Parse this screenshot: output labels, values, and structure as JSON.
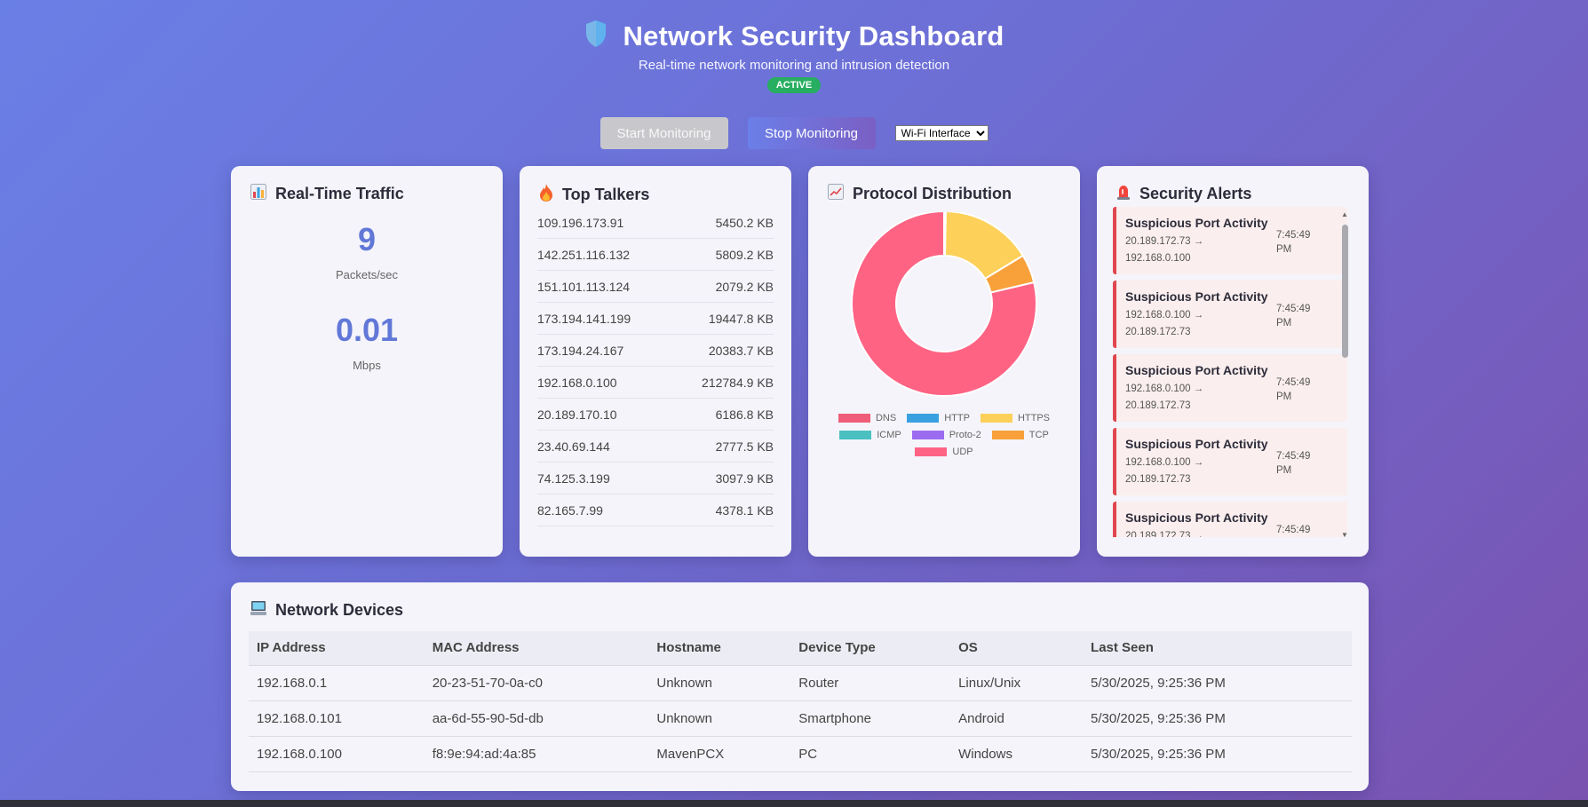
{
  "header": {
    "title": "Network Security Dashboard",
    "subtitle": "Real-time network monitoring and intrusion detection",
    "status_badge": "ACTIVE"
  },
  "controls": {
    "start_label": "Start Monitoring",
    "stop_label": "Stop Monitoring",
    "interface_selected": "Wi-Fi Interface"
  },
  "traffic": {
    "title": "Real-Time Traffic",
    "packets_value": "9",
    "packets_label": "Packets/sec",
    "mbps_value": "0.01",
    "mbps_label": "Mbps"
  },
  "talkers": {
    "title": "Top Talkers",
    "rows": [
      {
        "ip": "109.196.173.91",
        "size": "5450.2 KB"
      },
      {
        "ip": "142.251.116.132",
        "size": "5809.2 KB"
      },
      {
        "ip": "151.101.113.124",
        "size": "2079.2 KB"
      },
      {
        "ip": "173.194.141.199",
        "size": "19447.8 KB"
      },
      {
        "ip": "173.194.24.167",
        "size": "20383.7 KB"
      },
      {
        "ip": "192.168.0.100",
        "size": "212784.9 KB"
      },
      {
        "ip": "20.189.170.10",
        "size": "6186.8 KB"
      },
      {
        "ip": "23.40.69.144",
        "size": "2777.5 KB"
      },
      {
        "ip": "74.125.3.199",
        "size": "3097.9 KB"
      },
      {
        "ip": "82.165.7.99",
        "size": "4378.1 KB"
      }
    ]
  },
  "protocol": {
    "title": "Protocol Distribution",
    "legend": [
      {
        "name": "DNS",
        "color": "#f05d7a"
      },
      {
        "name": "HTTP",
        "color": "#3aa0e0"
      },
      {
        "name": "HTTPS",
        "color": "#fdd05a"
      },
      {
        "name": "ICMP",
        "color": "#4bc0c0"
      },
      {
        "name": "Proto-2",
        "color": "#9b6cf0"
      },
      {
        "name": "TCP",
        "color": "#f8a03a"
      },
      {
        "name": "UDP",
        "color": "#ff6384"
      }
    ]
  },
  "chart_data": {
    "type": "pie",
    "categories": [
      "DNS",
      "HTTP",
      "HTTPS",
      "ICMP",
      "Proto-2",
      "TCP",
      "UDP"
    ],
    "values": [
      0.3,
      0,
      16,
      0,
      0,
      5,
      78.7
    ],
    "title": "",
    "legend_position": "bottom"
  },
  "alerts": {
    "title": "Security Alerts",
    "items": [
      {
        "title": "Suspicious Port Activity",
        "route_from": "20.189.172.73 →",
        "route_to": "192.168.0.100",
        "time_a": "7:45:49",
        "time_b": "PM"
      },
      {
        "title": "Suspicious Port Activity",
        "route_from": "192.168.0.100 →",
        "route_to": "20.189.172.73",
        "time_a": "7:45:49",
        "time_b": "PM"
      },
      {
        "title": "Suspicious Port Activity",
        "route_from": "192.168.0.100 →",
        "route_to": "20.189.172.73",
        "time_a": "7:45:49",
        "time_b": "PM"
      },
      {
        "title": "Suspicious Port Activity",
        "route_from": "192.168.0.100 →",
        "route_to": "20.189.172.73",
        "time_a": "7:45:49",
        "time_b": "PM"
      },
      {
        "title": "Suspicious Port Activity",
        "route_from": "20.189.172.73 →",
        "route_to": "",
        "time_a": "7:45:49",
        "time_b": ""
      }
    ]
  },
  "devices": {
    "title": "Network Devices",
    "columns": [
      "IP Address",
      "MAC Address",
      "Hostname",
      "Device Type",
      "OS",
      "Last Seen"
    ],
    "rows": [
      [
        "192.168.0.1",
        "20-23-51-70-0a-c0",
        "Unknown",
        "Router",
        "Linux/Unix",
        "5/30/2025, 9:25:36 PM"
      ],
      [
        "192.168.0.101",
        "aa-6d-55-90-5d-db",
        "Unknown",
        "Smartphone",
        "Android",
        "5/30/2025, 9:25:36 PM"
      ],
      [
        "192.168.0.100",
        "f8:9e:94:ad:4a:85",
        "MavenPCX",
        "PC",
        "Windows",
        "5/30/2025, 9:25:36 PM"
      ]
    ]
  },
  "icons": {
    "header": "shield-icon",
    "traffic": "bar-chart-icon",
    "talkers": "fire-icon",
    "protocol": "line-chart-icon",
    "alerts": "siren-icon",
    "devices": "computer-icon"
  }
}
